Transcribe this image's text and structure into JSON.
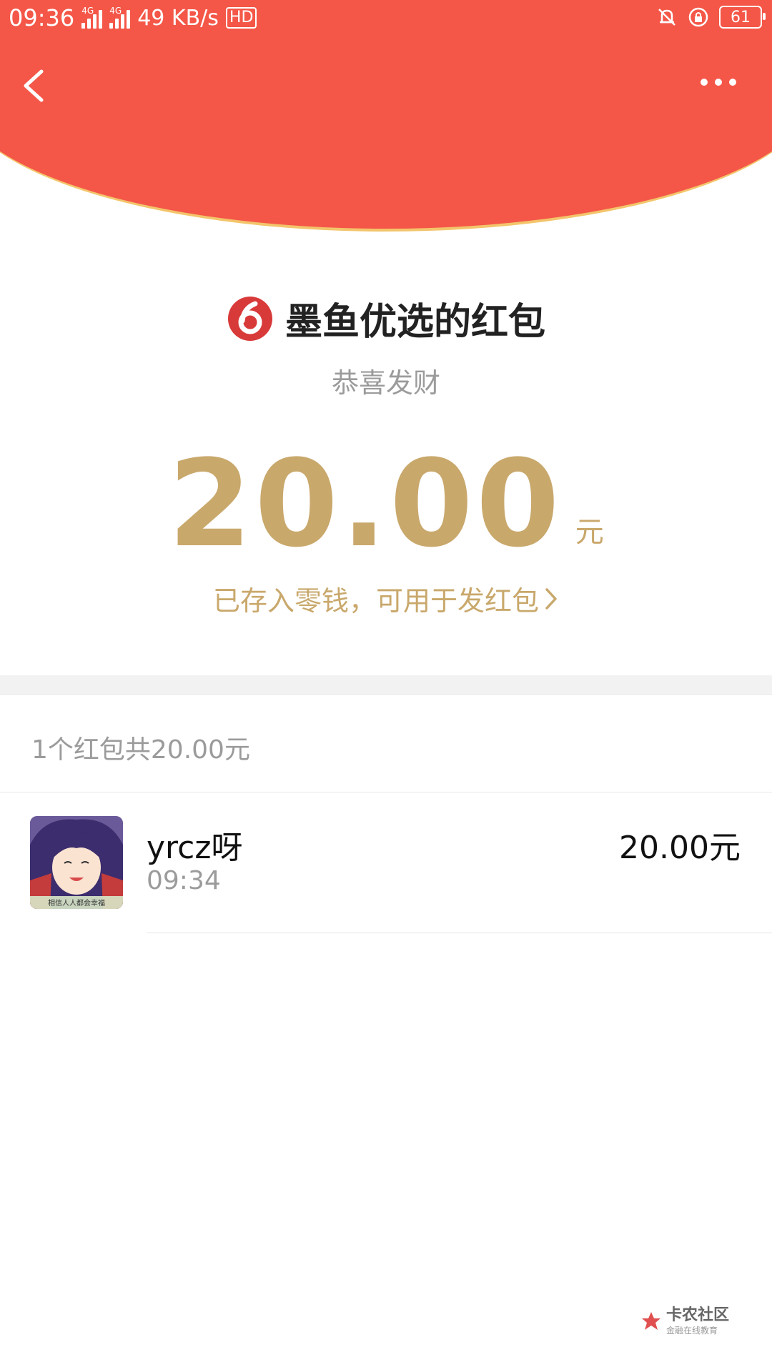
{
  "status_bar": {
    "time": "09:36",
    "signal1_tag": "4G",
    "signal2_tag": "4G",
    "speed": "49 KB/s",
    "hd_label": "HD",
    "battery": "61"
  },
  "header": {
    "back_icon": "chevron-left-icon",
    "more_icon": "more-dots-icon"
  },
  "packet": {
    "title": "墨鱼优选的红包",
    "greeting": "恭喜发财",
    "amount": "20.00",
    "unit": "元",
    "saved_note": "已存入零钱，可用于发红包"
  },
  "summary": "1个红包共20.00元",
  "records": [
    {
      "name": "yrcz呀",
      "time": "09:34",
      "amount": "20.00元",
      "avatar_caption": "相信人人都会幸福"
    }
  ],
  "watermark": {
    "main": "卡农社区",
    "sub": "金融在线教育"
  },
  "colors": {
    "header_red": "#f45748",
    "gold": "#c9a86c",
    "edge_gold": "#f3c56b"
  }
}
